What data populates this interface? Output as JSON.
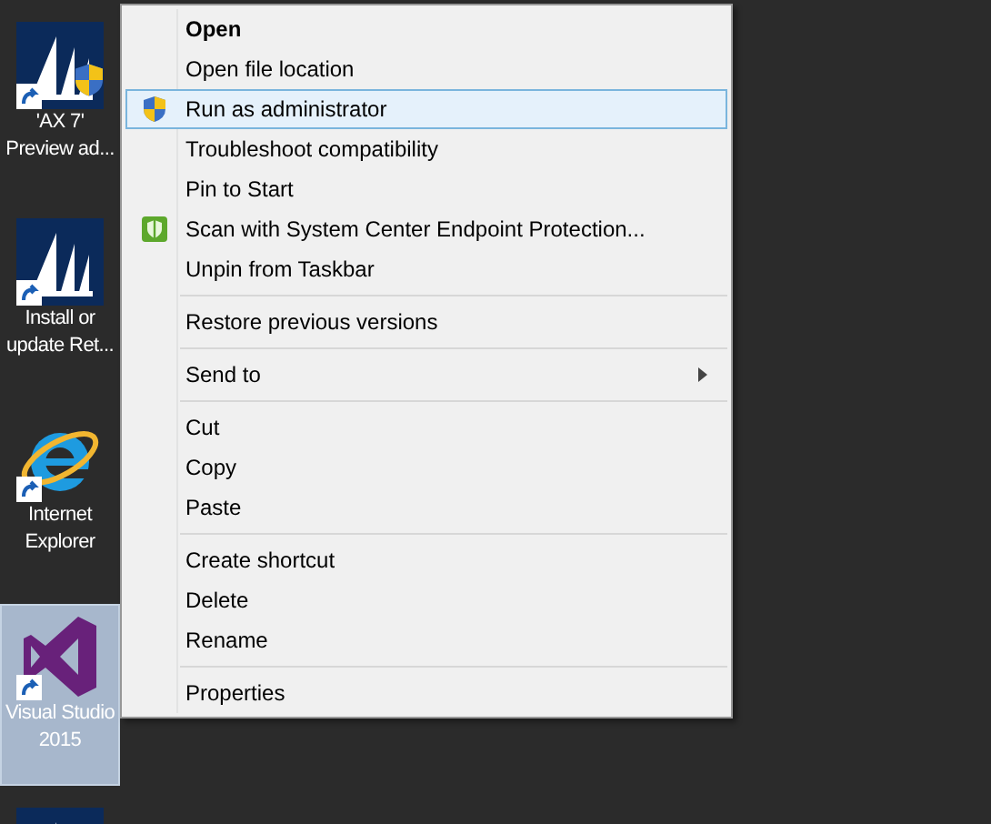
{
  "desktop_icons": [
    {
      "label_lines": [
        "'AX 7'",
        "Preview ad..."
      ],
      "kind": "sails",
      "shield": true,
      "selected": false
    },
    {
      "label_lines": [
        "Install or",
        "update Ret..."
      ],
      "kind": "sails",
      "shield": false,
      "selected": false
    },
    {
      "label_lines": [
        "Internet",
        "Explorer"
      ],
      "kind": "browser",
      "shield": false,
      "selected": false
    },
    {
      "label_lines": [
        "Visual Studio",
        "2015"
      ],
      "kind": "studio",
      "shield": false,
      "selected": true
    },
    {
      "kind": "sails",
      "selected": false
    }
  ],
  "context_menu": {
    "items": [
      {
        "kind": "item",
        "label": "Open",
        "bold": true,
        "selected": false
      },
      {
        "kind": "item",
        "label": "Open file location",
        "bold": false,
        "selected": false
      },
      {
        "kind": "admin",
        "label": "Run as administrator",
        "bold": false,
        "selected": true
      },
      {
        "kind": "item",
        "label": "Troubleshoot compatibility",
        "bold": false,
        "selected": false
      },
      {
        "kind": "item",
        "label": "Pin to Start",
        "bold": false,
        "selected": false
      },
      {
        "kind": "scan",
        "label": "Scan with System Center Endpoint Protection...",
        "bold": false,
        "selected": false
      },
      {
        "kind": "item",
        "label": "Unpin from Taskbar",
        "bold": false,
        "selected": false
      },
      {
        "kind": "separator"
      },
      {
        "kind": "item",
        "label": "Restore previous versions",
        "bold": false,
        "selected": false
      },
      {
        "kind": "separator"
      },
      {
        "kind": "submenu",
        "label": "Send to",
        "bold": false,
        "selected": false
      },
      {
        "kind": "separator"
      },
      {
        "kind": "item",
        "label": "Cut",
        "bold": false,
        "selected": false
      },
      {
        "kind": "item",
        "label": "Copy",
        "bold": false,
        "selected": false
      },
      {
        "kind": "item",
        "label": "Paste",
        "bold": false,
        "selected": false
      },
      {
        "kind": "separator"
      },
      {
        "kind": "item",
        "label": "Create shortcut",
        "bold": false,
        "selected": false
      },
      {
        "kind": "item",
        "label": "Delete",
        "bold": false,
        "selected": false
      },
      {
        "kind": "item",
        "label": "Rename",
        "bold": false,
        "selected": false
      },
      {
        "kind": "separator"
      },
      {
        "kind": "item",
        "label": "Properties",
        "bold": false,
        "selected": false
      }
    ]
  }
}
